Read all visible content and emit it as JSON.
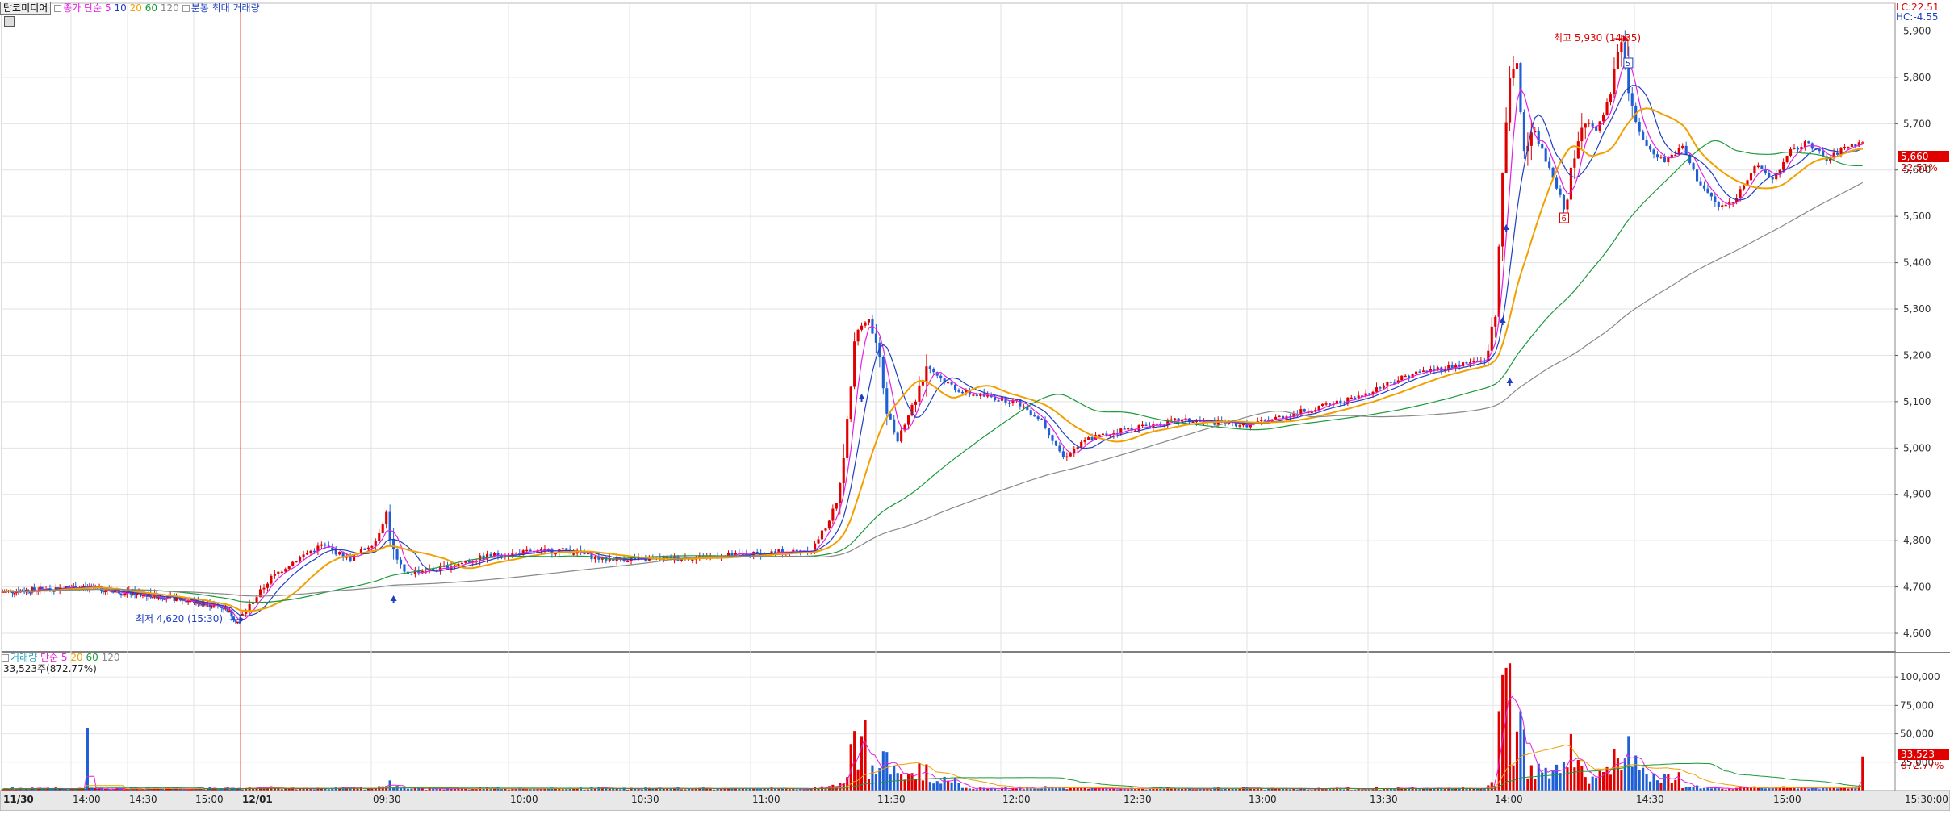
{
  "header": {
    "stock_name": "탑코미디어",
    "ma_label": "종가 단순",
    "ma_periods": [
      "5",
      "10",
      "20",
      "60",
      "120"
    ],
    "ma_colors": [
      "#e41ee4",
      "#1f3fbf",
      "#f0a000",
      "#1a9a3a",
      "#888888"
    ],
    "split_label": "분봉 최대 거래량",
    "lc_label": "LC:22.51",
    "hc_label": "HC:-4.55"
  },
  "volume_header": {
    "title": "거래량",
    "ma_label": "단순",
    "ma_periods": [
      "5",
      "20",
      "60",
      "120"
    ],
    "summary": "33,523주(872.77%)"
  },
  "annotations": {
    "high": "최고 5,930 (14:35)",
    "low": "최저 4,620 (15:30)",
    "marker_5": "5",
    "marker_6": "6"
  },
  "price_badge": {
    "value": "5,660",
    "pct": "22.51%"
  },
  "volume_badge": {
    "value": "33,523",
    "pct": "872.77%"
  },
  "chart_data": {
    "type": "candlestick",
    "price_ticks": [
      "5,900",
      "5,800",
      "5,700",
      "5,600",
      "5,500",
      "5,400",
      "5,300",
      "5,200",
      "5,100",
      "5,000",
      "4,900",
      "4,800",
      "4,700",
      "4,600"
    ],
    "volume_ticks": [
      "100,000",
      "75,000",
      "50,000",
      "25,000"
    ],
    "time_labels": [
      "11/30",
      "14:00",
      "14:30",
      "15:00",
      "12/01",
      "09:30",
      "10:00",
      "10:30",
      "11:00",
      "11:30",
      "12:00",
      "12:30",
      "13:00",
      "13:30",
      "14:00",
      "14:30",
      "15:00",
      "15:30:00"
    ],
    "ylim": [
      4560,
      5960
    ],
    "vol_max": 115000,
    "sessions": [
      {
        "label": "11/30",
        "anchors": [
          [
            0,
            4690
          ],
          [
            40,
            4700
          ],
          [
            80,
            4680
          ],
          [
            95,
            4670
          ],
          [
            113,
            4655
          ],
          [
            120,
            4620
          ]
        ]
      },
      {
        "label": "12/01",
        "anchors": [
          [
            0,
            4640
          ],
          [
            8,
            4720
          ],
          [
            15,
            4760
          ],
          [
            22,
            4790
          ],
          [
            30,
            4760
          ],
          [
            37,
            4800
          ],
          [
            40,
            4860
          ],
          [
            42,
            4770
          ],
          [
            45,
            4730
          ],
          [
            55,
            4740
          ],
          [
            70,
            4770
          ],
          [
            90,
            4780
          ],
          [
            100,
            4760
          ],
          [
            115,
            4760
          ],
          [
            140,
            4770
          ],
          [
            158,
            4780
          ],
          [
            162,
            4830
          ],
          [
            165,
            4880
          ],
          [
            168,
            5050
          ],
          [
            170,
            5250
          ],
          [
            174,
            5280
          ],
          [
            176,
            5220
          ],
          [
            180,
            5050
          ],
          [
            182,
            5020
          ],
          [
            186,
            5090
          ],
          [
            190,
            5180
          ],
          [
            194,
            5150
          ],
          [
            200,
            5120
          ],
          [
            215,
            5100
          ],
          [
            222,
            5060
          ],
          [
            228,
            4980
          ],
          [
            235,
            5020
          ],
          [
            245,
            5040
          ],
          [
            260,
            5060
          ],
          [
            280,
            5050
          ],
          [
            295,
            5080
          ],
          [
            310,
            5110
          ],
          [
            318,
            5140
          ],
          [
            325,
            5160
          ],
          [
            338,
            5180
          ],
          [
            345,
            5190
          ],
          [
            348,
            5280
          ],
          [
            350,
            5600
          ],
          [
            352,
            5780
          ],
          [
            354,
            5830
          ],
          [
            356,
            5640
          ],
          [
            358,
            5700
          ],
          [
            362,
            5620
          ],
          [
            365,
            5560
          ],
          [
            367,
            5520
          ],
          [
            370,
            5620
          ],
          [
            373,
            5720
          ],
          [
            376,
            5680
          ],
          [
            380,
            5760
          ],
          [
            383,
            5880
          ],
          [
            386,
            5720
          ],
          [
            390,
            5650
          ],
          [
            395,
            5620
          ],
          [
            400,
            5650
          ],
          [
            404,
            5580
          ],
          [
            410,
            5520
          ],
          [
            414,
            5530
          ],
          [
            420,
            5610
          ],
          [
            425,
            5580
          ],
          [
            430,
            5640
          ],
          [
            435,
            5660
          ],
          [
            440,
            5620
          ],
          [
            445,
            5650
          ],
          [
            450,
            5660
          ]
        ]
      }
    ],
    "volume_spikes": [
      [
        0,
        43,
        55000
      ],
      [
        1,
        172,
        48000
      ],
      [
        1,
        173,
        62000
      ],
      [
        1,
        349,
        70000
      ],
      [
        1,
        351,
        108000
      ],
      [
        1,
        352,
        112000
      ],
      [
        1,
        354,
        52000
      ],
      [
        1,
        385,
        48000
      ],
      [
        1,
        450,
        30000
      ]
    ],
    "high": 5930,
    "low": 4620,
    "close": 5660
  }
}
